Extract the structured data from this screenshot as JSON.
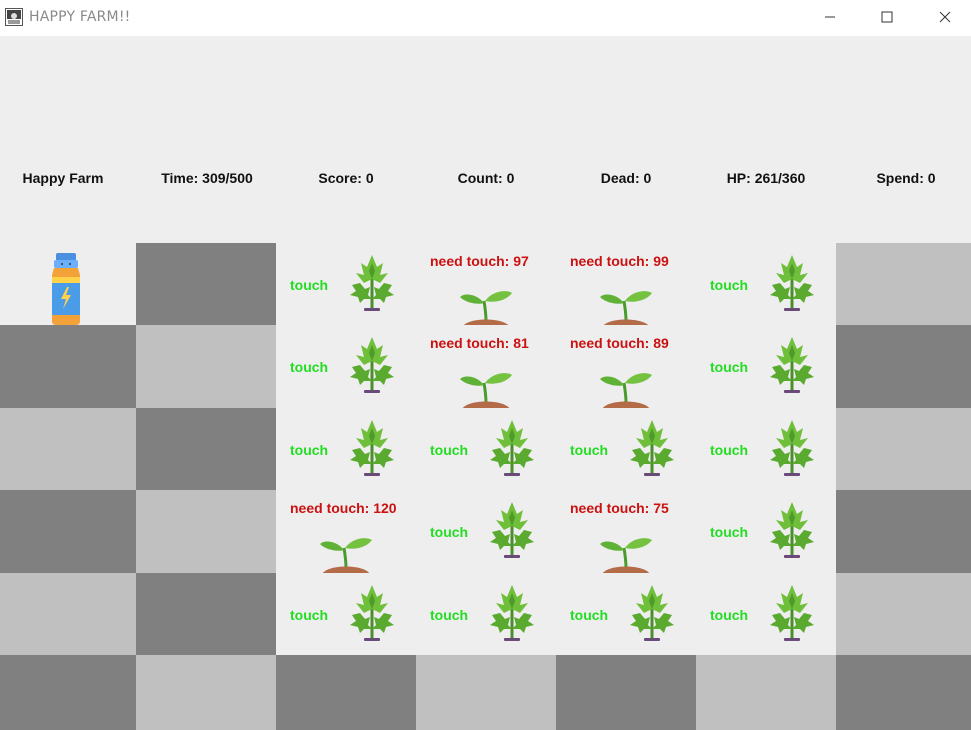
{
  "window": {
    "title": "HAPPY FARM!!"
  },
  "hud": {
    "name": "Happy Farm",
    "time": "Time: 309/500",
    "score": "Score: 0",
    "count": "Count: 0",
    "dead": "Dead: 0",
    "hp": "HP: 261/360",
    "spend": "Spend: 0"
  },
  "item": {
    "icon": "energy-drink-bottle-icon"
  },
  "grid": [
    [
      "bottle",
      "dark",
      "plant",
      "sprout",
      "sprout",
      "plant",
      "light"
    ],
    [
      "dark",
      "light",
      "plant",
      "sprout",
      "sprout",
      "plant",
      "dark"
    ],
    [
      "light",
      "dark",
      "plant",
      "plant",
      "plant",
      "plant",
      "light"
    ],
    [
      "dark",
      "light",
      "sprout",
      "plant",
      "sprout",
      "plant",
      "dark"
    ],
    [
      "light",
      "dark",
      "plant",
      "plant",
      "plant",
      "plant",
      "light"
    ],
    [
      "dark",
      "light",
      "dark",
      "light",
      "dark",
      "light",
      "dark"
    ]
  ],
  "cells": [
    {
      "row": 0,
      "col": 2,
      "label": "touch"
    },
    {
      "row": 0,
      "col": 3,
      "label": "need touch: 97"
    },
    {
      "row": 0,
      "col": 4,
      "label": "need touch: 99"
    },
    {
      "row": 0,
      "col": 5,
      "label": "touch"
    },
    {
      "row": 1,
      "col": 2,
      "label": "touch"
    },
    {
      "row": 1,
      "col": 3,
      "label": "need touch: 81"
    },
    {
      "row": 1,
      "col": 4,
      "label": "need touch: 89"
    },
    {
      "row": 1,
      "col": 5,
      "label": "touch"
    },
    {
      "row": 2,
      "col": 2,
      "label": "touch"
    },
    {
      "row": 2,
      "col": 3,
      "label": "touch"
    },
    {
      "row": 2,
      "col": 4,
      "label": "touch"
    },
    {
      "row": 2,
      "col": 5,
      "label": "touch"
    },
    {
      "row": 3,
      "col": 2,
      "label": "need touch: 120"
    },
    {
      "row": 3,
      "col": 3,
      "label": "touch"
    },
    {
      "row": 3,
      "col": 4,
      "label": "need touch: 75"
    },
    {
      "row": 3,
      "col": 5,
      "label": "touch"
    },
    {
      "row": 4,
      "col": 2,
      "label": "touch"
    },
    {
      "row": 4,
      "col": 3,
      "label": "touch"
    },
    {
      "row": 4,
      "col": 4,
      "label": "touch"
    },
    {
      "row": 4,
      "col": 5,
      "label": "touch"
    }
  ],
  "colors": {
    "dark": "#808080",
    "light": "#c0c0c0",
    "field": "#eeeeee",
    "ready": "#22dd22",
    "need": "#cc1111"
  }
}
